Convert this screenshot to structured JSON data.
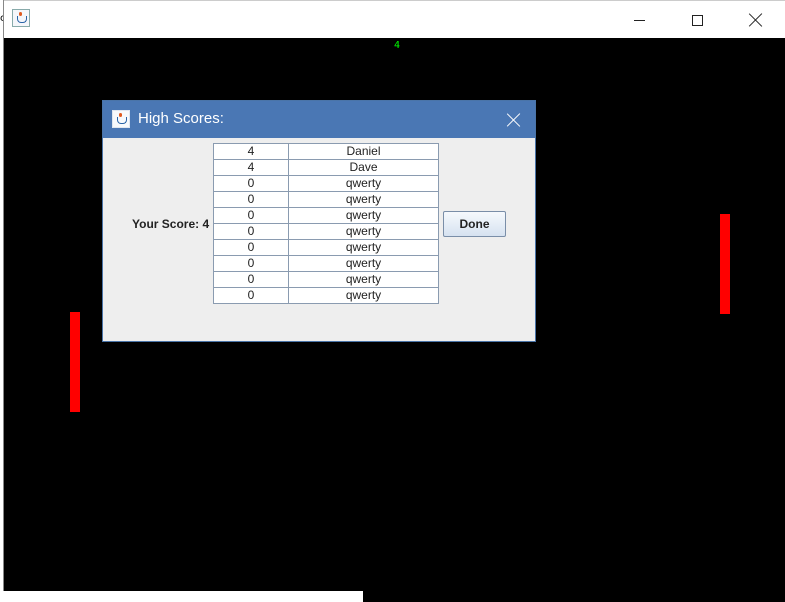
{
  "window": {
    "title": "",
    "controls": {
      "minimize_icon": "minimize-icon",
      "maximize_icon": "maximize-icon",
      "close_icon": "close-icon"
    }
  },
  "game": {
    "score": "4",
    "colors": {
      "background": "#000000",
      "paddle": "#ff0000",
      "score_text": "#00ff00"
    }
  },
  "dialog": {
    "title": "High Scores:",
    "your_score_label": "Your Score: 4",
    "done_label": "Done",
    "title_bar_color": "#4a77b4",
    "scores": [
      {
        "score": "4",
        "name": "Daniel"
      },
      {
        "score": "4",
        "name": "Dave"
      },
      {
        "score": "0",
        "name": "qwerty"
      },
      {
        "score": "0",
        "name": "qwerty"
      },
      {
        "score": "0",
        "name": "qwerty"
      },
      {
        "score": "0",
        "name": "qwerty"
      },
      {
        "score": "0",
        "name": "qwerty"
      },
      {
        "score": "0",
        "name": "qwerty"
      },
      {
        "score": "0",
        "name": "qwerty"
      },
      {
        "score": "0",
        "name": "qwerty"
      }
    ]
  }
}
